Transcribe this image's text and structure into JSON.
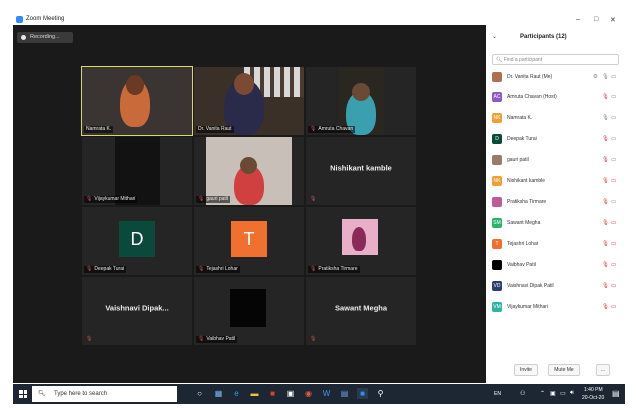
{
  "window": {
    "title": "Zoom Meeting"
  },
  "recording": {
    "label": "Recording..."
  },
  "tiles": [
    {
      "name": "Namrata K.",
      "muted": false
    },
    {
      "name": "Dr. Vanita Raut",
      "muted": false
    },
    {
      "name": "Amruta Chavan",
      "muted": true
    },
    {
      "name": "Vijaykumar Mithari",
      "muted": true
    },
    {
      "name": "gauri patil",
      "muted": true
    },
    {
      "name": "Nishikant kamble",
      "muted": true
    },
    {
      "name": "Deepak Turai",
      "muted": true,
      "initial": "D"
    },
    {
      "name": "Tejashri Lohar",
      "muted": true,
      "initial": "T"
    },
    {
      "name": "Pratiksha Tirmare",
      "muted": true
    },
    {
      "name": "Vaishnavi  Dipak...",
      "muted": true
    },
    {
      "name": "Vaibhav Patil",
      "muted": true
    },
    {
      "name": "Sawant Megha",
      "muted": true
    }
  ],
  "panel": {
    "title": "Participants (12)",
    "search_placeholder": "Find a participant",
    "participants": [
      {
        "name": "Dr. Vanita Raut (Me)",
        "initials": "",
        "color": "#b07050",
        "mic": "on",
        "video": "on"
      },
      {
        "name": "Amruta Chavan (Host)",
        "initials": "AC",
        "color": "#8e59c7",
        "mic": "muted",
        "video": "on"
      },
      {
        "name": "Namrata K.",
        "initials": "NK",
        "color": "#f0a030",
        "mic": "on",
        "video": "on"
      },
      {
        "name": "Deepak Turai",
        "initials": "D",
        "color": "#0a4a3a",
        "mic": "muted",
        "video": "on"
      },
      {
        "name": "gauri patil",
        "initials": "",
        "color": "#9a7a6a",
        "mic": "muted",
        "video": "on"
      },
      {
        "name": "Nishikant kamble",
        "initials": "NK",
        "color": "#f0a030",
        "mic": "muted",
        "video": "off"
      },
      {
        "name": "Pratiksha Tirmare",
        "initials": "",
        "color": "#c05a9a",
        "mic": "muted",
        "video": "on"
      },
      {
        "name": "Sawant Megha",
        "initials": "SM",
        "color": "#2eb36a",
        "mic": "muted",
        "video": "off"
      },
      {
        "name": "Tejashri Lohar",
        "initials": "T",
        "color": "#f07030",
        "mic": "muted",
        "video": "off"
      },
      {
        "name": "Vaibhav Patil",
        "initials": "",
        "color": "#000000",
        "mic": "muted",
        "video": "off"
      },
      {
        "name": "Vaishnavi Dipak Patil",
        "initials": "VD",
        "color": "#2b3e6e",
        "mic": "muted",
        "video": "off"
      },
      {
        "name": "Vijaykumar Mithari",
        "initials": "VM",
        "color": "#2eb3a0",
        "mic": "muted",
        "video": "off"
      }
    ],
    "invite_label": "Invite",
    "mute_me_label": "Mute Me",
    "more_label": "..."
  },
  "taskbar": {
    "search_placeholder": "Type here to search",
    "lang": "EN",
    "time": "1:40 PM",
    "date": "20-Oct-20"
  },
  "colors": {
    "accent": "#2d8cff",
    "muted": "#e04040",
    "active_speaker": "#d9d96a"
  }
}
